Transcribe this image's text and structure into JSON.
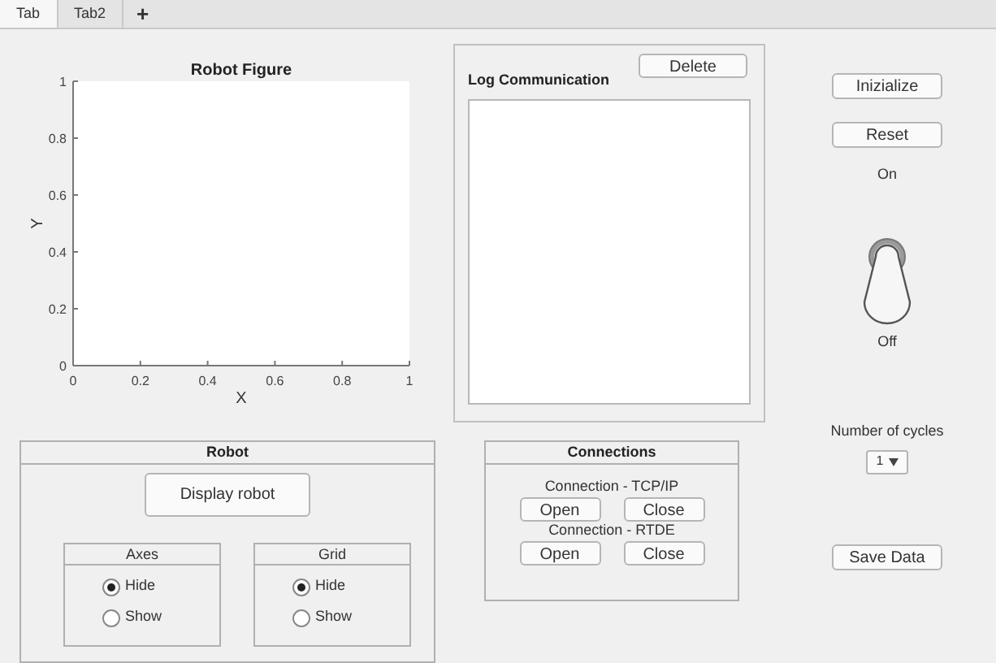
{
  "tabs": [
    {
      "label": "Tab",
      "selected": true
    },
    {
      "label": "Tab2",
      "selected": false
    }
  ],
  "add_tab": "+",
  "robot_figure": {
    "chart_data": {
      "type": "line",
      "title": "Robot Figure",
      "xlabel": "X",
      "ylabel": "Y",
      "xlim": [
        0,
        1
      ],
      "ylim": [
        0,
        1
      ],
      "xticks": [
        0,
        0.2,
        0.4,
        0.6,
        0.8,
        1
      ],
      "yticks": [
        0,
        0.2,
        0.4,
        0.6,
        0.8,
        1
      ]
    }
  },
  "log_communication": {
    "title": "Log Communication",
    "delete_button": "Delete"
  },
  "robot_panel": {
    "title": "Robot",
    "display_button": "Display robot",
    "groups": [
      {
        "title": "Axes",
        "options": [
          {
            "label": "Hide",
            "selected": true
          },
          {
            "label": "Show",
            "selected": false
          }
        ]
      },
      {
        "title": "Grid",
        "options": [
          {
            "label": "Hide",
            "selected": true
          },
          {
            "label": "Show",
            "selected": false
          }
        ]
      }
    ]
  },
  "connections": {
    "title": "Connections",
    "sections": [
      {
        "label": "Connection - TCP/IP",
        "buttons": [
          "Open",
          "Close"
        ]
      },
      {
        "label": "Connection - RTDE",
        "buttons": [
          "Open",
          "Close"
        ]
      }
    ]
  },
  "controls": {
    "initialize_button": "Inizialize",
    "reset_button": "Reset",
    "switch": {
      "on_label": "On",
      "off_label": "Off",
      "on": false
    },
    "cycles": {
      "label": "Number of cycles",
      "value": "1"
    },
    "save_button": "Save Data"
  }
}
